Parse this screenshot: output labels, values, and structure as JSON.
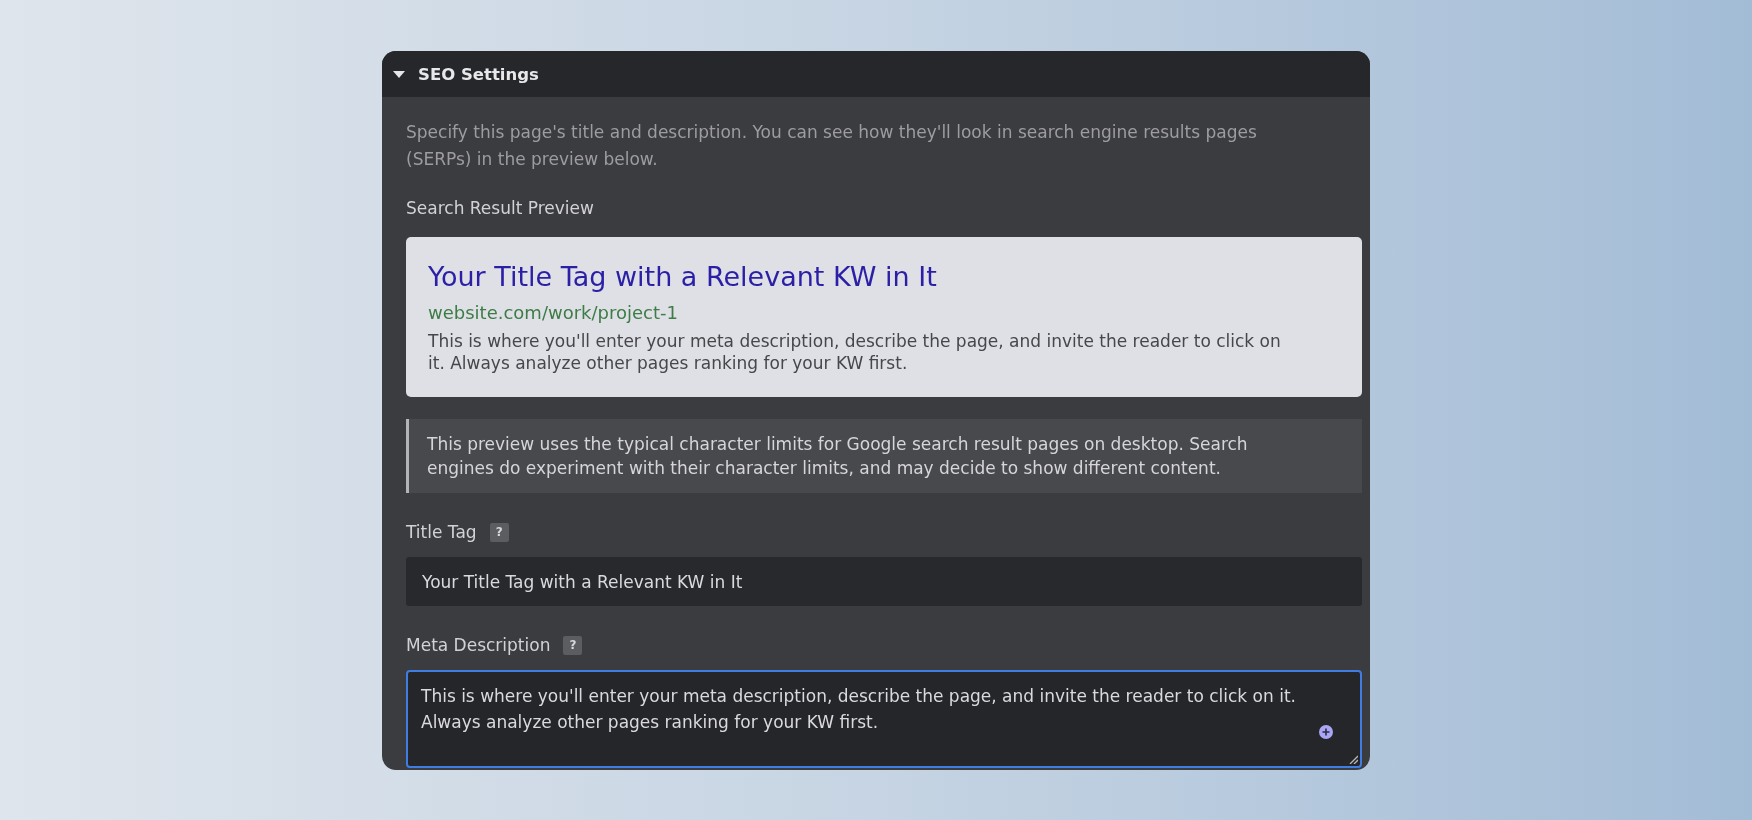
{
  "section": {
    "title": "SEO Settings",
    "expanded": true,
    "description": "Specify this page's title and description. You can see how they'll look in search engine results pages (SERPs) in the preview below.",
    "preview_label": "Search Result Preview",
    "preview": {
      "title": "Your Title Tag with a Relevant KW in It",
      "url": "website.com/work/project-1",
      "description": "This is where you'll enter your meta description, describe the page, and invite the reader to click on it. Always analyze other pages ranking for your KW first."
    },
    "note": "This preview uses the typical character limits for Google search result pages on desktop. Search engines do experiment with their character limits, and may decide to show different content.",
    "fields": [
      {
        "kind": "input",
        "label": "Title Tag",
        "help": "?",
        "value": "Your Title Tag with a Relevant KW in It",
        "focused": false
      },
      {
        "kind": "textarea",
        "label": "Meta Description",
        "help": "?",
        "value": "This is where you'll enter your meta description, describe the page, and invite the reader to click on it. Always analyze other pages ranking for your KW first.",
        "focused": true
      }
    ]
  }
}
